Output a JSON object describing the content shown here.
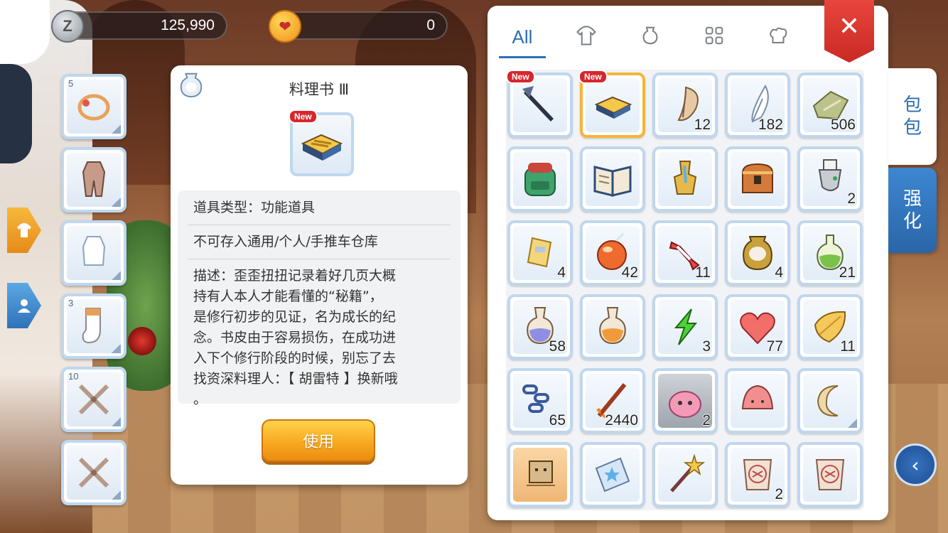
{
  "currency": {
    "zeny": "125,990",
    "cat_coin": "0",
    "zeny_icon_glyph": "Z",
    "cat_icon_glyph": "❤"
  },
  "equipment_slots": [
    {
      "count": "5",
      "icon": "ring-icon"
    },
    {
      "count": "",
      "icon": "body-suit-icon"
    },
    {
      "count": "",
      "icon": "top-garment-icon"
    },
    {
      "count": "3",
      "icon": "socks-icon"
    },
    {
      "count": "10",
      "icon": "rope-cross-icon"
    },
    {
      "count": "",
      "icon": "rope-cross-icon"
    }
  ],
  "detail": {
    "title": "料理书 Ⅲ",
    "new_badge": "New",
    "item_type": "道具类型：功能道具",
    "storage_note": "不可存入通用/个人/手推车仓库",
    "description_lines": [
      "描述：歪歪扭扭记录着好几页大概",
      "持有人本人才能看懂的“秘籍”，",
      "是修行初步的见证，名为成长的纪",
      "念。书皮由于容易损伤，在成功进",
      "入下个修行阶段的时候，别忘了去",
      "找资深料理人：【 胡雷特 】换新哦",
      "。"
    ],
    "use_button": "使用"
  },
  "inventory": {
    "tabs": [
      {
        "label": "All",
        "icon": "all-tab",
        "active": true
      },
      {
        "label": "",
        "icon": "shirt-icon"
      },
      {
        "label": "",
        "icon": "pouch-icon"
      },
      {
        "label": "",
        "icon": "grid-icon"
      },
      {
        "label": "",
        "icon": "chef-hat-icon"
      }
    ],
    "close_label": "✕",
    "items": [
      {
        "name": "pickaxe-icon",
        "qty": "",
        "new": "New"
      },
      {
        "name": "cookbook-icon",
        "qty": "",
        "new": "New",
        "selected": true
      },
      {
        "name": "butterfly-wing-icon",
        "qty": "12"
      },
      {
        "name": "feather-icon",
        "qty": "182"
      },
      {
        "name": "cloth-scrap-icon",
        "qty": "506"
      },
      {
        "name": "backpack-icon",
        "qty": ""
      },
      {
        "name": "open-book-icon",
        "qty": ""
      },
      {
        "name": "golden-statue-icon",
        "qty": ""
      },
      {
        "name": "treasure-bag-icon",
        "qty": ""
      },
      {
        "name": "skeleton-hat-icon",
        "qty": "2"
      },
      {
        "name": "badge-icon",
        "qty": "4"
      },
      {
        "name": "apple-juice-icon",
        "qty": "42"
      },
      {
        "name": "candy-icon",
        "qty": "11"
      },
      {
        "name": "jar-icon",
        "qty": "4"
      },
      {
        "name": "green-potion-icon",
        "qty": "21"
      },
      {
        "name": "blue-potion-icon",
        "qty": "58"
      },
      {
        "name": "orange-potion-icon",
        "qty": ""
      },
      {
        "name": "lightning-icon",
        "qty": "3"
      },
      {
        "name": "heart-icon",
        "qty": "77"
      },
      {
        "name": "yellow-leaf-icon",
        "qty": "11"
      },
      {
        "name": "chain-icon",
        "qty": "65"
      },
      {
        "name": "fire-sword-icon",
        "qty": "2440"
      },
      {
        "name": "pink-poring-icon",
        "qty": "2",
        "style": "gray"
      },
      {
        "name": "pink-hat-icon",
        "qty": ""
      },
      {
        "name": "crescent-cookie-icon",
        "qty": ""
      },
      {
        "name": "box-card-icon",
        "qty": "",
        "style": "orange"
      },
      {
        "name": "blue-star-card-icon",
        "qty": ""
      },
      {
        "name": "star-wand-icon",
        "qty": ""
      },
      {
        "name": "scroll-icon",
        "qty": "2"
      },
      {
        "name": "scroll-icon",
        "qty": ""
      }
    ]
  },
  "side_tabs": {
    "bag": [
      "包",
      "包"
    ],
    "enhance": [
      "强",
      "化"
    ]
  },
  "back_button": "‹"
}
